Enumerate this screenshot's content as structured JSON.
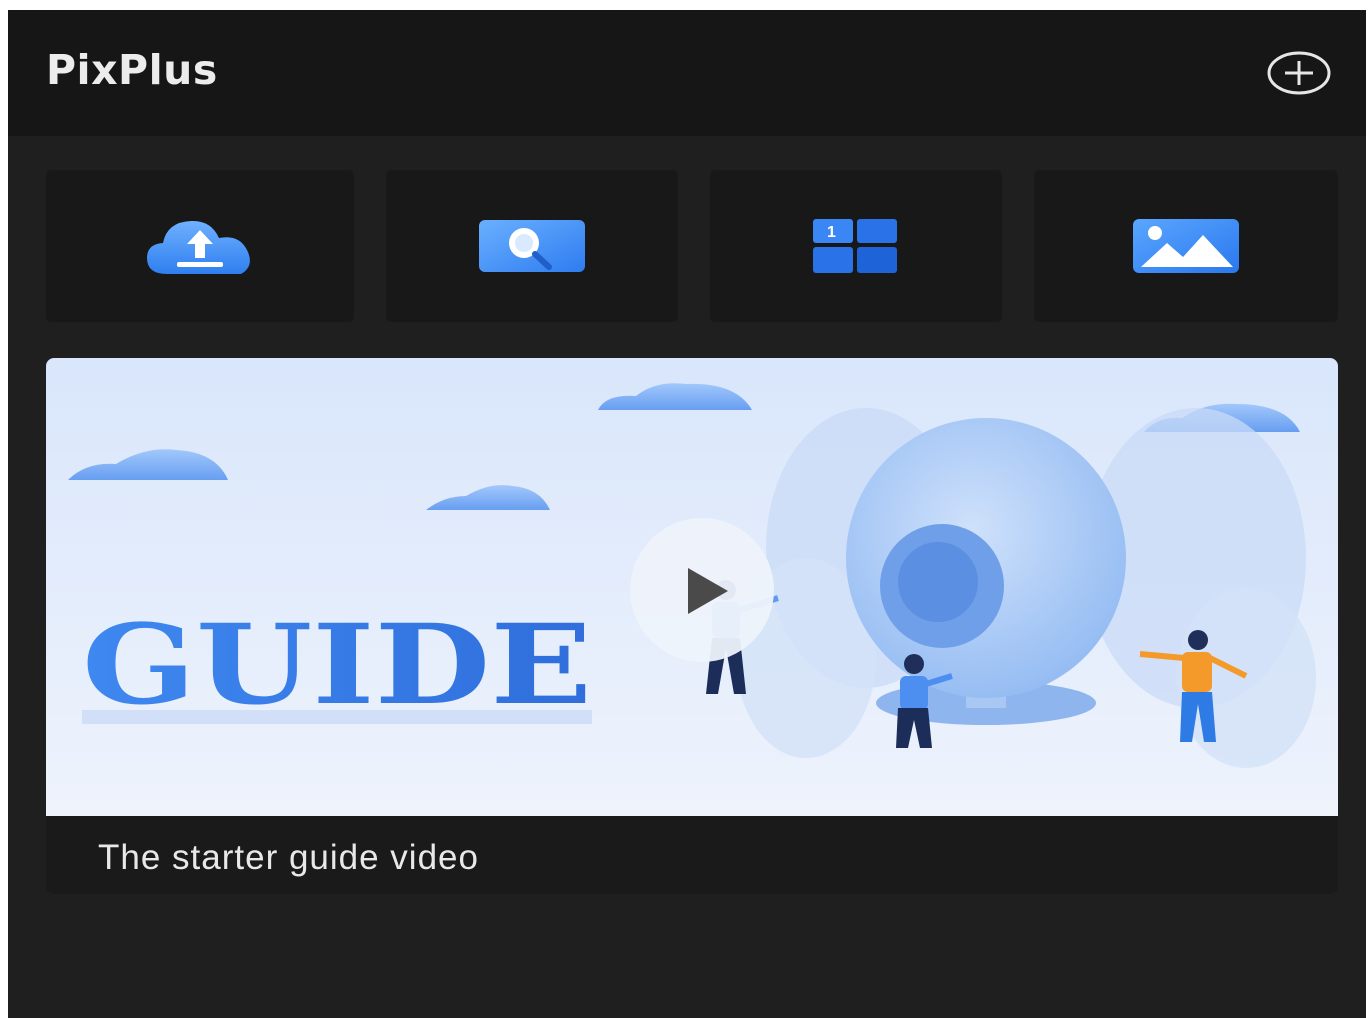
{
  "app": {
    "title": "PixPlus"
  },
  "header": {
    "add_icon": "plus-circle-icon"
  },
  "tools": [
    {
      "icon": "cloud-upload-icon"
    },
    {
      "icon": "image-search-icon"
    },
    {
      "icon": "grid-layout-icon",
      "badge": "1"
    },
    {
      "icon": "image-gallery-icon"
    }
  ],
  "guide": {
    "banner_text": "GUIDE",
    "caption": "The starter guide video",
    "play_icon": "play-icon"
  },
  "colors": {
    "background": "#1f1f1f",
    "header": "#161616",
    "accent": "#3d8ef6",
    "text": "#e8e8e8"
  }
}
